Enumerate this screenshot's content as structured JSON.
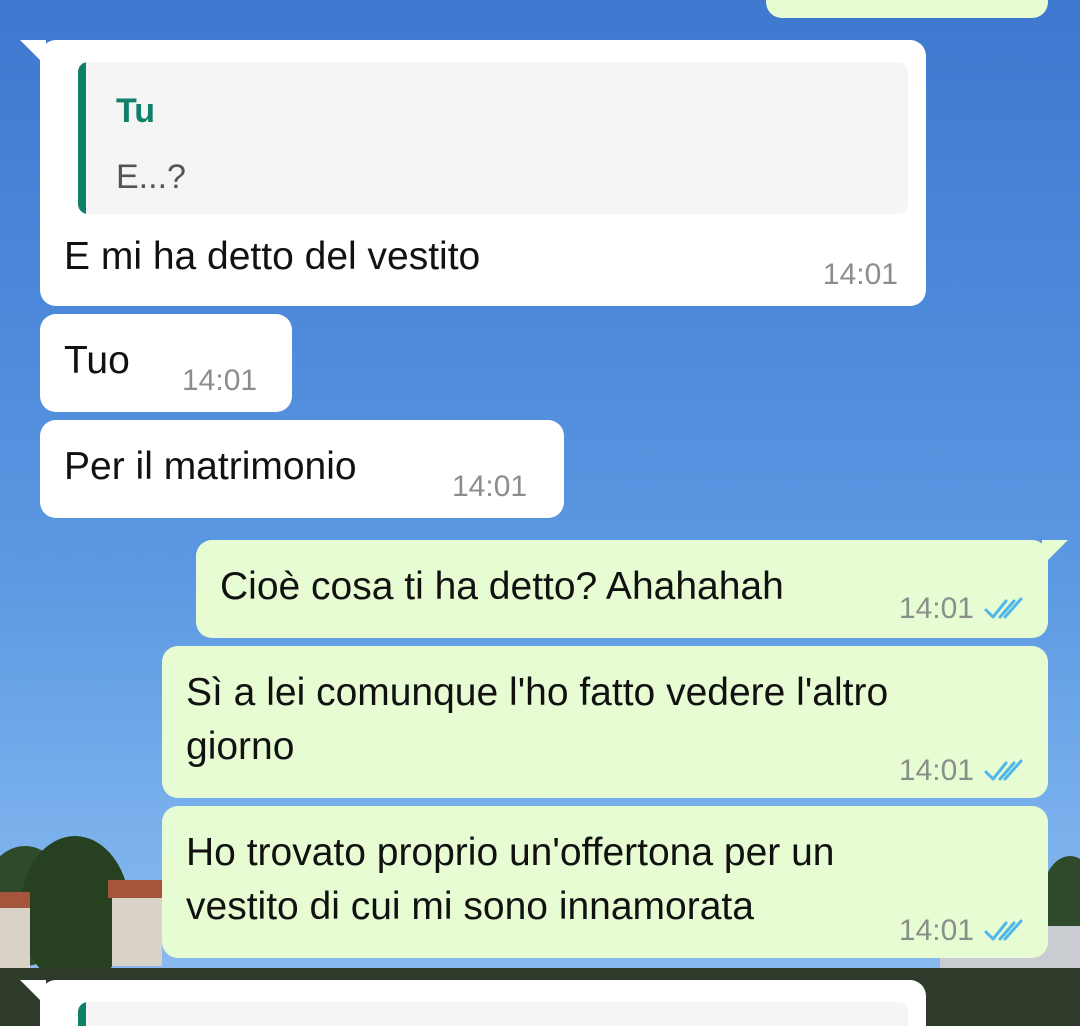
{
  "chat": {
    "messages": [
      {
        "direction": "incoming",
        "quote": {
          "author": "Tu",
          "text": "E...?"
        },
        "text": "E mi ha detto del vestito",
        "time": "14:01"
      },
      {
        "direction": "incoming",
        "text": "Tuo",
        "time": "14:01"
      },
      {
        "direction": "incoming",
        "text": "Per il matrimonio",
        "time": "14:01"
      },
      {
        "direction": "outgoing",
        "text": "Cioè cosa ti ha detto? Ahahahah",
        "time": "14:01",
        "status": "read"
      },
      {
        "direction": "outgoing",
        "text_line1": "Sì a lei comunque l'ho fatto vedere l'altro",
        "text_line2": "giorno",
        "time": "14:01",
        "status": "read"
      },
      {
        "direction": "outgoing",
        "text_line1": "Ho trovato proprio un'offertona per un",
        "text_line2": "vestito di cui mi sono innamorata",
        "time": "14:01",
        "status": "read"
      }
    ]
  },
  "colors": {
    "incoming_bubble": "#ffffff",
    "outgoing_bubble": "#e7fcd2",
    "quote_accent": "#11806a",
    "read_ticks": "#4fb6ec"
  },
  "icons": {
    "read_status": "double-check-icon"
  }
}
